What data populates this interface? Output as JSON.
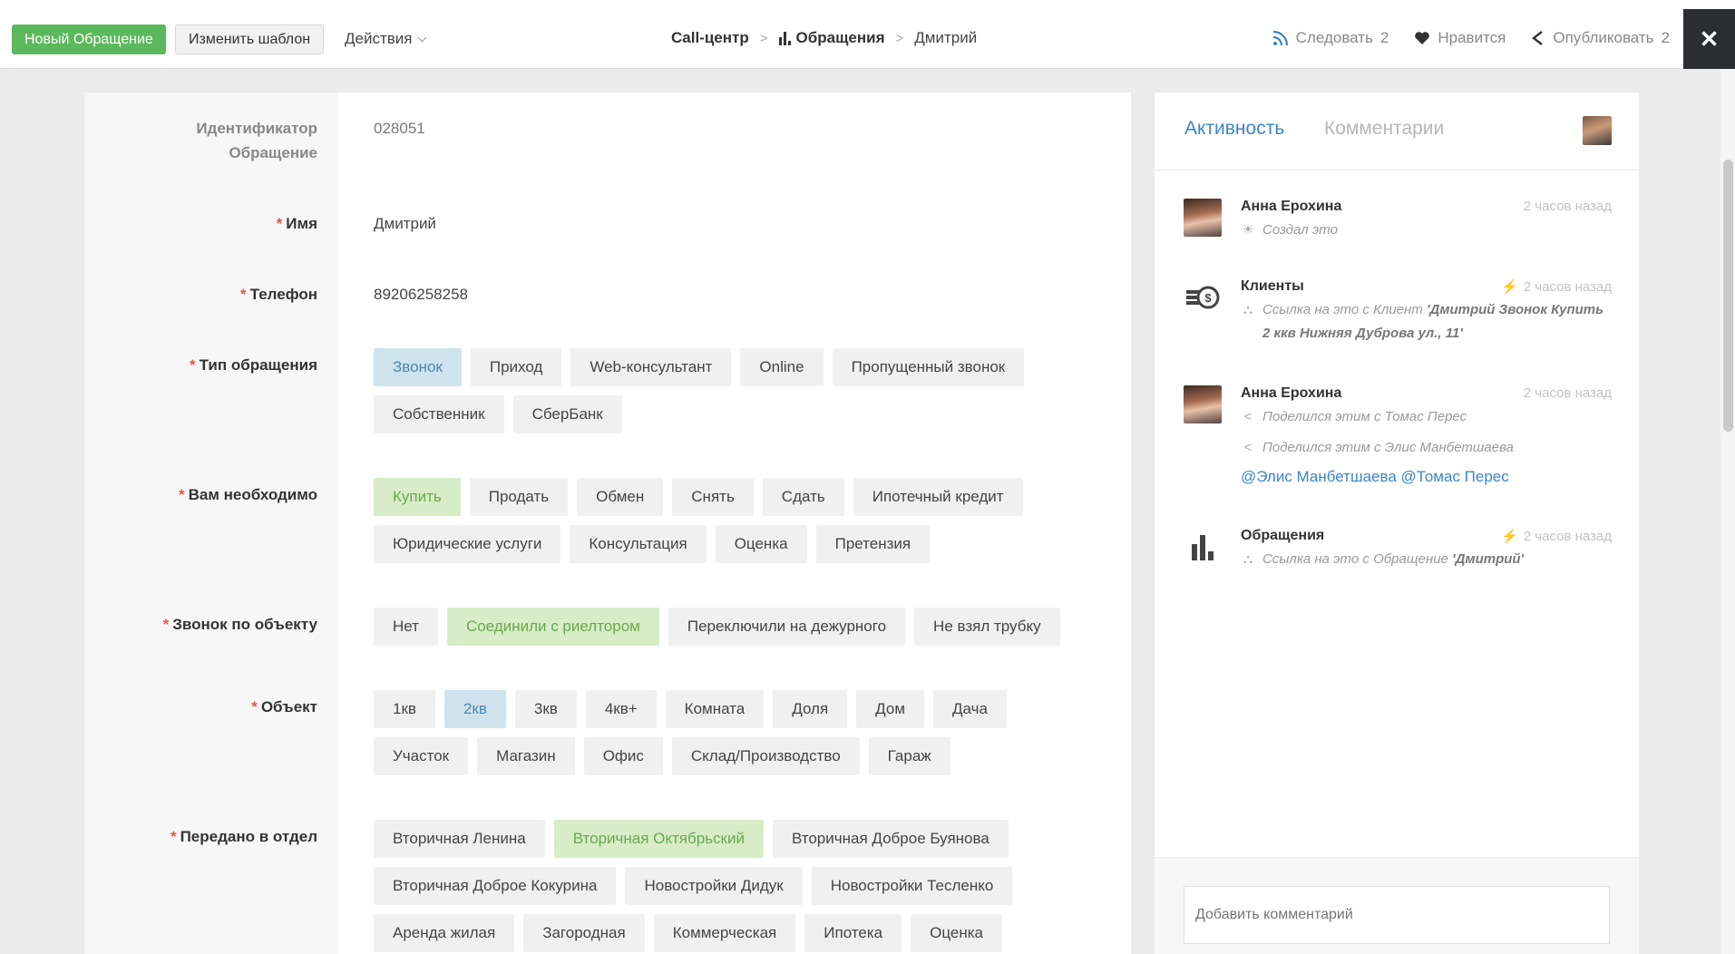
{
  "toolbar": {
    "new_label": "Новый Обращение",
    "template_label": "Изменить шаблон",
    "actions_label": "Действия"
  },
  "breadcrumb": {
    "root": "Call-центр",
    "section": "Обращения",
    "current": "Дмитрий"
  },
  "header_actions": {
    "follow_label": "Следовать",
    "follow_count": "2",
    "like_label": "Нравится",
    "publish_label": "Опубликовать",
    "publish_count": "2",
    "close": "✕"
  },
  "form": {
    "id_label": "Идентификатор Обращение",
    "id_value": "028051",
    "name_label": "Имя",
    "name_value": "Дмитрий",
    "phone_label": "Телефон",
    "phone_value": "89206258258",
    "request_type": {
      "label": "Тип обращения",
      "options": [
        "Звонок",
        "Приход",
        "Web-консультант",
        "Online",
        "Пропущенный звонок",
        "Собственник",
        "СберБанк"
      ],
      "selected": "Звонок"
    },
    "need": {
      "label": "Вам необходимо",
      "options": [
        "Купить",
        "Продать",
        "Обмен",
        "Снять",
        "Сдать",
        "Ипотечный кредит",
        "Юридические услуги",
        "Консультация",
        "Оценка",
        "Претензия"
      ],
      "selected": "Купить"
    },
    "call": {
      "label": "Звонок по объекту",
      "options": [
        "Нет",
        "Соединили с риелтором",
        "Переключили на дежурного",
        "Не взял трубку"
      ],
      "selected": "Соединили с риелтором"
    },
    "object": {
      "label": "Объект",
      "options": [
        "1кв",
        "2кв",
        "3кв",
        "4кв+",
        "Комната",
        "Доля",
        "Дом",
        "Дача",
        "Участок",
        "Магазин",
        "Офис",
        "Склад/Производство",
        "Гараж"
      ],
      "selected": "2кв"
    },
    "department": {
      "label": "Передано в отдел",
      "options": [
        "Вторичная Ленина",
        "Вторичная Октябрьский",
        "Вторичная Доброе Буянова",
        "Вторичная Доброе Кокурина",
        "Новостройки Дидук",
        "Новостройки Тесленко",
        "Аренда жилая",
        "Загородная",
        "Коммерческая",
        "Ипотека",
        "Оценка"
      ],
      "selected": "Вторичная Октябрьский"
    }
  },
  "activity": {
    "tab_activity": "Активность",
    "tab_comments": "Комментарии",
    "items": [
      {
        "name": "Анна Ерохина",
        "time": "2 часов назад",
        "lines": [
          "Создал это"
        ]
      },
      {
        "name": "Клиенты",
        "time": "2 часов назад",
        "line_prefix": "Ссылка на это с Клиент",
        "line_bold": "'Дмитрий Звонок Купить 2 ккв Нижняя Дуброва ул., 11'"
      },
      {
        "name": "Анна Ерохина",
        "time": "2 часов назад",
        "lines": [
          "Поделился этим с Томас Перес",
          "Поделился этим с Элис Манбетшаева"
        ],
        "mentions": "@Элис Манбетшаева @Томас Перес"
      },
      {
        "name": "Обращения",
        "time": "2 часов назад",
        "line_prefix": "Ссылка на это с Обращение",
        "line_bold": "'Дмитрий'"
      }
    ],
    "comment_placeholder": "Добавить комментарий"
  },
  "colors": {
    "accent_green": "#5cb85c",
    "chip_blue": "#cfe3ee",
    "chip_green": "#d7ecc7",
    "link_blue": "#3b86c4"
  }
}
